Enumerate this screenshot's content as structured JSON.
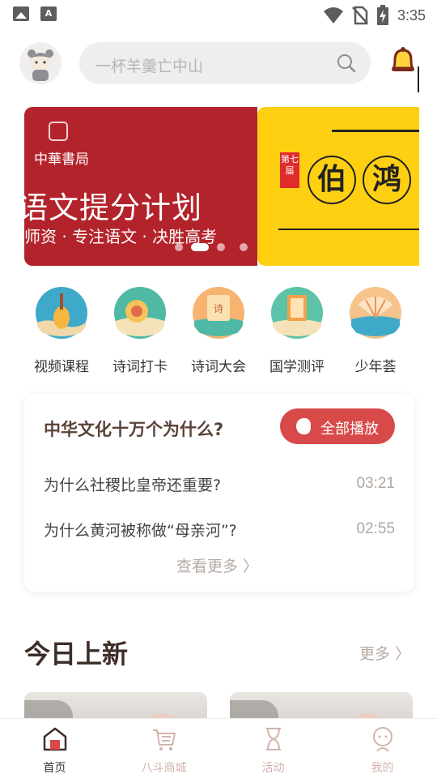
{
  "status_bar": {
    "time": "3:35",
    "left_icons": [
      "image-icon",
      "font-a-icon"
    ],
    "right_icons": [
      "wifi-icon",
      "no-sim-icon",
      "battery-charging-icon"
    ]
  },
  "header": {
    "search_placeholder": "一杯羊羹亡中山"
  },
  "banner": {
    "slides": [
      {
        "publisher": "中華書局",
        "headline": "语文提分计划",
        "subline": "师资 · 专注语文 · 决胜高考",
        "bg": "#b3232b"
      },
      {
        "badge": "第七届",
        "chars": [
          "伯",
          "鸿"
        ],
        "bg": "#ffd012"
      }
    ],
    "dots_total": 4,
    "active_dot": 2
  },
  "grid": [
    {
      "label": "视频课程",
      "icon": "lute-icon",
      "color": "#3fa9c9"
    },
    {
      "label": "诗词打卡",
      "icon": "poem-seal-icon",
      "color": "#4fb9a5"
    },
    {
      "label": "诗词大会",
      "icon": "scroll-icon",
      "color": "#f0a55a"
    },
    {
      "label": "国学测评",
      "icon": "book-icon",
      "color": "#5cc2a8"
    },
    {
      "label": "少年荟",
      "icon": "fan-icon",
      "color": "#f29a6b"
    }
  ],
  "card": {
    "title": "中华文化十万个为什么?",
    "play_all": "全部播放",
    "items": [
      {
        "question": "为什么社稷比皇帝还重要?",
        "duration": "03:21"
      },
      {
        "question": "为什么黄河被称做“母亲河”?",
        "duration": "02:55"
      }
    ],
    "more": "查看更多 〉"
  },
  "section": {
    "title": "今日上新",
    "more": "更多 〉"
  },
  "tabbar": [
    {
      "label": "首页",
      "icon": "home-icon",
      "active": true
    },
    {
      "label": "八斗商城",
      "icon": "cart-icon",
      "active": false
    },
    {
      "label": "活动",
      "icon": "hourglass-icon",
      "active": false
    },
    {
      "label": "我的",
      "icon": "profile-icon",
      "active": false
    }
  ],
  "colors": {
    "accent": "#d84a4a",
    "title_brown": "#5b4338",
    "muted": "#b7aaa3"
  }
}
